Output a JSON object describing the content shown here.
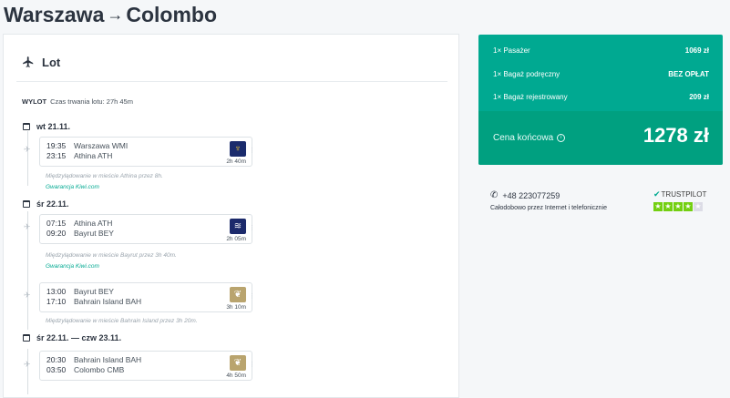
{
  "route": {
    "from": "Warszawa",
    "arrow": "→",
    "to": "Colombo"
  },
  "card": {
    "title": "Lot",
    "direction": "WYLOT",
    "duration": "Czas trwania lotu: 27h 45m"
  },
  "days": [
    {
      "label": "wt 21.11."
    },
    {
      "label": "śr 22.11."
    },
    {
      "label": "śr 22.11. — czw 23.11."
    }
  ],
  "segments": [
    {
      "dep_time": "19:35",
      "dep_place": "Warszawa WMI",
      "arr_time": "23:15",
      "arr_place": "Athina ATH",
      "duration": "2h 40m",
      "airline_icon": "ryanair-harp-icon",
      "logo_bg": "#1a2b6c",
      "logo_fg": "#f1c933"
    },
    {
      "dep_time": "07:15",
      "dep_place": "Athina ATH",
      "arr_time": "09:20",
      "arr_place": "Bayrut BEY",
      "duration": "2h 05m",
      "airline_icon": "aegean-icon",
      "logo_bg": "#1c2a6b",
      "logo_fg": "#ffffff"
    },
    {
      "dep_time": "13:00",
      "dep_place": "Bayrut BEY",
      "arr_time": "17:10",
      "arr_place": "Bahrain Island BAH",
      "duration": "3h 10m",
      "airline_icon": "gulf-air-falcon-icon",
      "logo_bg": "#b9a46e",
      "logo_fg": "#ffffff"
    },
    {
      "dep_time": "20:30",
      "dep_place": "Bahrain Island BAH",
      "arr_time": "03:50",
      "arr_place": "Colombo CMB",
      "duration": "4h 50m",
      "airline_icon": "gulf-air-falcon-icon",
      "logo_bg": "#b9a46e",
      "logo_fg": "#ffffff"
    }
  ],
  "layovers": [
    {
      "text": "Międzylądowanie w mieście Athina przez 8h.",
      "guarantee": "Gwarancja Kiwi.com"
    },
    {
      "text": "Międzylądowanie w mieście Bayrut przez 3h 40m.",
      "guarantee": "Gwarancja Kiwi.com"
    },
    {
      "text": "Międzylądowanie w mieście Bahrain Island przez 3h 20m.",
      "guarantee": ""
    }
  ],
  "price": {
    "rows": [
      {
        "label": "1× Pasażer",
        "value": "1069 zł"
      },
      {
        "label": "1× Bagaż podręczny",
        "value": "BEZ OPŁAT"
      },
      {
        "label": "1× Bagaż rejestrowany",
        "value": "209 zł"
      }
    ],
    "final_label": "Cena końcowa",
    "final_value": "1278 zł",
    "accent": "#00a991"
  },
  "contact": {
    "phone": "+48 223077259",
    "subtitle": "Całodobowo przez Internet i telefonicznie"
  },
  "trustpilot": {
    "brand": "TRUSTPILOT",
    "stars": 4,
    "max_stars": 5
  }
}
